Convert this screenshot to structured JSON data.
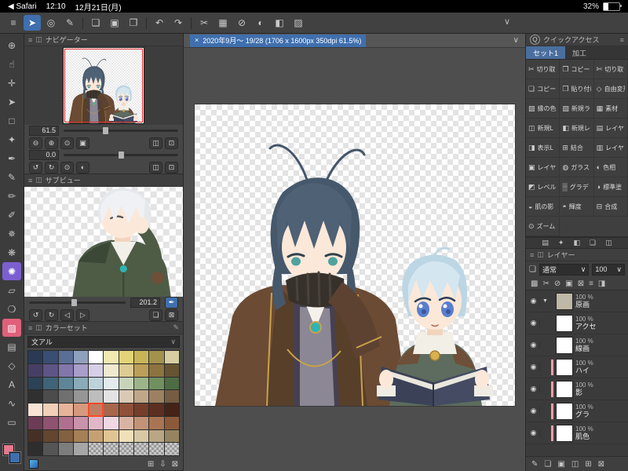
{
  "statusbar": {
    "back": "◀ Safari",
    "time": "12:10",
    "date": "12月21日(月)",
    "battery_pct": "32%"
  },
  "ui": {
    "menu_icon": "≡",
    "panel_icon": "◫",
    "edit_icon": "✎"
  },
  "topbar": {
    "chevron": "∨",
    "icons": [
      {
        "g": "≡",
        "n": "menu-icon"
      },
      {
        "g": "➤",
        "n": "operate-tool-icon",
        "active": true
      },
      {
        "g": "◎",
        "n": "select-tool-icon"
      },
      {
        "g": "✎",
        "n": "pen-mode-icon"
      },
      {
        "g": "",
        "n": "divider",
        "divider": true
      },
      {
        "g": "❏",
        "n": "new-canvas-icon"
      },
      {
        "g": "▣",
        "n": "save-icon"
      },
      {
        "g": "❐",
        "n": "export-icon"
      },
      {
        "g": "",
        "n": "divider",
        "divider": true
      },
      {
        "g": "↶",
        "n": "undo-icon"
      },
      {
        "g": "↷",
        "n": "redo-icon"
      },
      {
        "g": "",
        "n": "divider",
        "divider": true
      },
      {
        "g": "✂",
        "n": "cut-icon"
      },
      {
        "g": "▦",
        "n": "select-all-icon"
      },
      {
        "g": "⊘",
        "n": "deselect-icon"
      },
      {
        "g": "◐",
        "n": "invert-selection-icon"
      },
      {
        "g": "◧",
        "n": "fill-icon"
      },
      {
        "g": "▨",
        "n": "border-effect-icon"
      }
    ]
  },
  "tabbar": {
    "close": "×",
    "title": "2020年9月〜 19/28 (1706 x 1600px 350dpi 61.5%)",
    "chevron": "∨"
  },
  "toolbar_left": {
    "main_color": "#e8788c",
    "sub_color": "#3f6fae",
    "tools": [
      {
        "g": "⊕",
        "n": "zoom-tool-icon"
      },
      {
        "g": "☝",
        "n": "hand-tool-icon"
      },
      {
        "g": "✛",
        "n": "move-layer-tool-icon"
      },
      {
        "g": "➤",
        "n": "operate-tool-icon"
      },
      {
        "g": "□",
        "n": "selection-tool-icon"
      },
      {
        "g": "✦",
        "n": "auto-select-tool-icon"
      },
      {
        "g": "✒",
        "n": "eyedropper-tool-icon"
      },
      {
        "g": "✎",
        "n": "pen-tool-icon"
      },
      {
        "g": "✏",
        "n": "pencil-tool-icon"
      },
      {
        "g": "✐",
        "n": "brush-tool-icon"
      },
      {
        "g": "✵",
        "n": "airbrush-tool-icon"
      },
      {
        "g": "❋",
        "n": "decoration-tool-icon"
      },
      {
        "g": "✺",
        "n": "liquify-tool-icon",
        "accent": "purple"
      },
      {
        "g": "▱",
        "n": "eraser-tool-icon"
      },
      {
        "g": "❍",
        "n": "blend-tool-icon"
      },
      {
        "g": "▨",
        "n": "fill-tool-icon",
        "accent": "pink"
      },
      {
        "g": "▤",
        "n": "gradient-tool-icon"
      },
      {
        "g": "◇",
        "n": "figure-tool-icon"
      },
      {
        "g": "A",
        "n": "text-tool-icon"
      },
      {
        "g": "∿",
        "n": "line-correct-tool-icon"
      },
      {
        "g": "▭",
        "n": "frame-tool-icon"
      }
    ]
  },
  "navigator": {
    "title": "ナビゲーター",
    "zoom_value": "61.5",
    "rotate_value": "0.0",
    "zoom_buttons": [
      "⊖",
      "⊕",
      "⊙",
      "▣",
      {
        "spacer": true
      },
      "◫",
      "⊡"
    ],
    "rotate_buttons": [
      "↺",
      "↻",
      "⊙",
      "◐",
      {
        "spacer": true
      },
      "◫",
      "⊡"
    ]
  },
  "subview": {
    "title": "サブビュー",
    "zoom_value": "201.2",
    "auto_icon": "✒",
    "buttons": [
      "↺",
      "↻",
      "◁",
      "▷",
      {
        "spacer": true
      },
      "❏",
      "⊠"
    ]
  },
  "colorset": {
    "title": "カラーセット",
    "set_name": "文アル",
    "dropdown_chevron": "∨",
    "bottom_icons": [
      "⊞",
      "⇩",
      "⊠"
    ],
    "selected_index": 44,
    "swatches": [
      "#2a3a55",
      "#3a4e73",
      "#5b6f96",
      "#8fa0bd",
      "#ffffff",
      "#f2e9b0",
      "#e3d478",
      "#c9b457",
      "#a3924c",
      "#d7cfa2",
      "#463f63",
      "#5f5486",
      "#8376ab",
      "#a99dc9",
      "#d6cfe6",
      "#efe9cf",
      "#dccb92",
      "#bb9f58",
      "#8c7340",
      "#665433",
      "#2c4255",
      "#3f6377",
      "#5f8598",
      "#8aabb9",
      "#bdd2db",
      "#e4ebec",
      "#c8d4ba",
      "#9cb489",
      "#71905f",
      "#4e6c44",
      "#303030",
      "#4c4c4c",
      "#707070",
      "#969696",
      "#bdbdbd",
      "#e3e3e3",
      "#dacab5",
      "#bfa78a",
      "#9b8161",
      "#745d43",
      "#f8e3d4",
      "#f2cfb8",
      "#e7b49a",
      "#d59a7e",
      "#c07f63",
      "#a8664c",
      "#8e5038",
      "#743e2a",
      "#5c2f20",
      "#452317",
      "#6d3b55",
      "#8f5270",
      "#b06f8e",
      "#cb92ab",
      "#e1b7c8",
      "#f0d8e2",
      "#d9b3a4",
      "#c29376",
      "#a97452",
      "#8c5a3b",
      "#463026",
      "#64452f",
      "#83603f",
      "#a57f55",
      "#c4a072",
      "#e0c493",
      "#f0e0b8",
      "#d8c8a4",
      "#b8a684",
      "#968460",
      "#2e2e2e",
      "#555555",
      "#7d7d7d",
      "#a6a6a6",
      "",
      "",
      "",
      "",
      "",
      ""
    ]
  },
  "quick_access": {
    "icon": "Q",
    "title": "クイックアクセス",
    "tabs": [
      {
        "t": "セット1",
        "n": "quick-access-tab-set1",
        "active": true
      },
      {
        "t": "加工",
        "n": "quick-access-tab-kakou"
      }
    ],
    "items": [
      {
        "g": "✂",
        "t": "切り取り"
      },
      {
        "g": "❐",
        "t": "コピー"
      },
      {
        "g": "✄",
        "t": "切り取り"
      },
      {
        "g": "❏",
        "t": "コピー"
      },
      {
        "g": "❒",
        "t": "貼り付け"
      },
      {
        "g": "◇",
        "t": "自由変形"
      },
      {
        "g": "▨",
        "t": "縁の色"
      },
      {
        "g": "▧",
        "t": "新規ラ"
      },
      {
        "g": "▦",
        "t": "素材"
      },
      {
        "g": "◫",
        "t": "新規L"
      },
      {
        "g": "◧",
        "t": "新規レ"
      },
      {
        "g": "▤",
        "t": "レイヤ"
      },
      {
        "g": "◨",
        "t": "表示L"
      },
      {
        "g": "⊞",
        "t": "結合"
      },
      {
        "g": "▥",
        "t": "レイヤ"
      },
      {
        "g": "▣",
        "t": "レイヤ"
      },
      {
        "g": "◍",
        "t": "ガラス"
      },
      {
        "g": "◐",
        "t": "色相"
      },
      {
        "g": "◩",
        "t": "レベル"
      },
      {
        "g": "▒",
        "t": "グラデ"
      },
      {
        "g": "◑",
        "t": "標準塗"
      },
      {
        "g": "◒",
        "t": "肌の影"
      },
      {
        "g": "◓",
        "t": "輝度"
      },
      {
        "g": "⊟",
        "t": "合成"
      },
      {
        "g": "⊙",
        "t": "ズーム"
      }
    ]
  },
  "dock_tabs": [
    "▤",
    "✦",
    "◧",
    "❏",
    "◫"
  ],
  "layers": {
    "title": "レイヤー",
    "eye_icon": "◉",
    "blend_icon": "❏",
    "blend_label": "通常",
    "blend_chevron": "∨",
    "opacity_value": "100",
    "opacity_chevron": "∨",
    "tool_icons": [
      "▩",
      "✂",
      "⊘",
      "▣",
      "⊠",
      "≡",
      "◨"
    ],
    "bottom_icons": [
      "✎",
      "❏",
      "▣",
      "◫",
      "⊞",
      "⊠"
    ],
    "rows": [
      {
        "arrow": "▼",
        "name": "原画",
        "opacity": "100 %",
        "folder": true
      },
      {
        "arrow": "",
        "name": "アクセ",
        "opacity": "100 %"
      },
      {
        "arrow": "",
        "name": "線画",
        "opacity": "100 %"
      },
      {
        "arrow": "",
        "name": "ハイ",
        "opacity": "100 %",
        "clip": true
      },
      {
        "arrow": "",
        "name": "影",
        "opacity": "100 %",
        "clip": true
      },
      {
        "arrow": "",
        "name": "グラ",
        "opacity": "100 %",
        "clip": true
      },
      {
        "arrow": "",
        "name": "肌色",
        "opacity": "100 %",
        "clip": true
      }
    ]
  }
}
